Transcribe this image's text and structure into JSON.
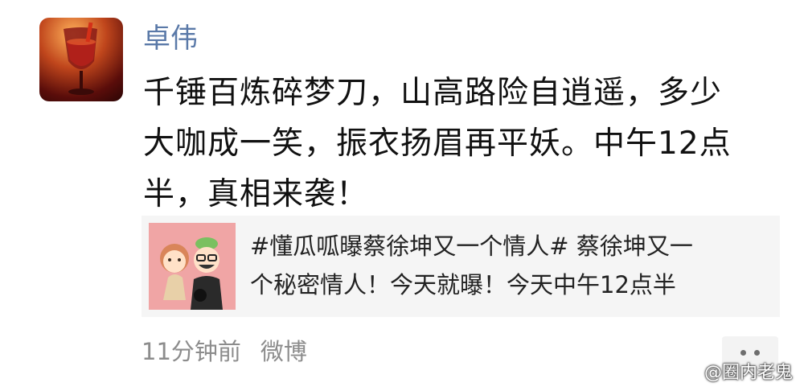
{
  "post": {
    "author": "卓伟",
    "text_lines": [
      "千锤百炼碎梦刀，山高路险自逍遥，多少",
      "大咖成一笑，振衣扬眉再平妖。中午12点",
      "半，真相来袭！"
    ]
  },
  "link_card": {
    "text_lines": [
      "#懂瓜呱曝蔡徐坤又一个情人# 蔡徐坤又一",
      "个秘密情人！今天就曝！今天中午12点半"
    ]
  },
  "meta": {
    "time": "11分钟前",
    "source": "微博"
  },
  "watermark": {
    "text": "@圈内老鬼"
  },
  "icons": {
    "avatar": "wine-glass-sunset-avatar",
    "thumb": "cartoon-couple-thumbnail",
    "more": "more-dots-icon",
    "watermark": "weibo-logo-icon"
  },
  "colors": {
    "author": "#5a79a8",
    "text": "#111111",
    "meta": "#8c8c8c",
    "card_bg": "#f5f5f5",
    "thumb_bg": "#f0a5a5"
  }
}
